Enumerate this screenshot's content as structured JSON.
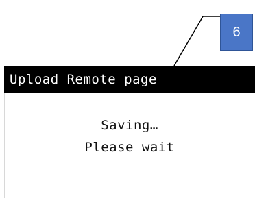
{
  "callout": {
    "number": "6",
    "colors": {
      "fill": "#4a76c7",
      "border": "#2f5597",
      "text": "#ffffff",
      "line": "#000000"
    }
  },
  "screen": {
    "title": "Upload Remote page",
    "message": [
      "Saving…",
      "Please wait"
    ],
    "colors": {
      "title_bg": "#000000",
      "title_text": "#ffffff",
      "body_bg": "#ffffff",
      "body_text": "#111111"
    }
  }
}
